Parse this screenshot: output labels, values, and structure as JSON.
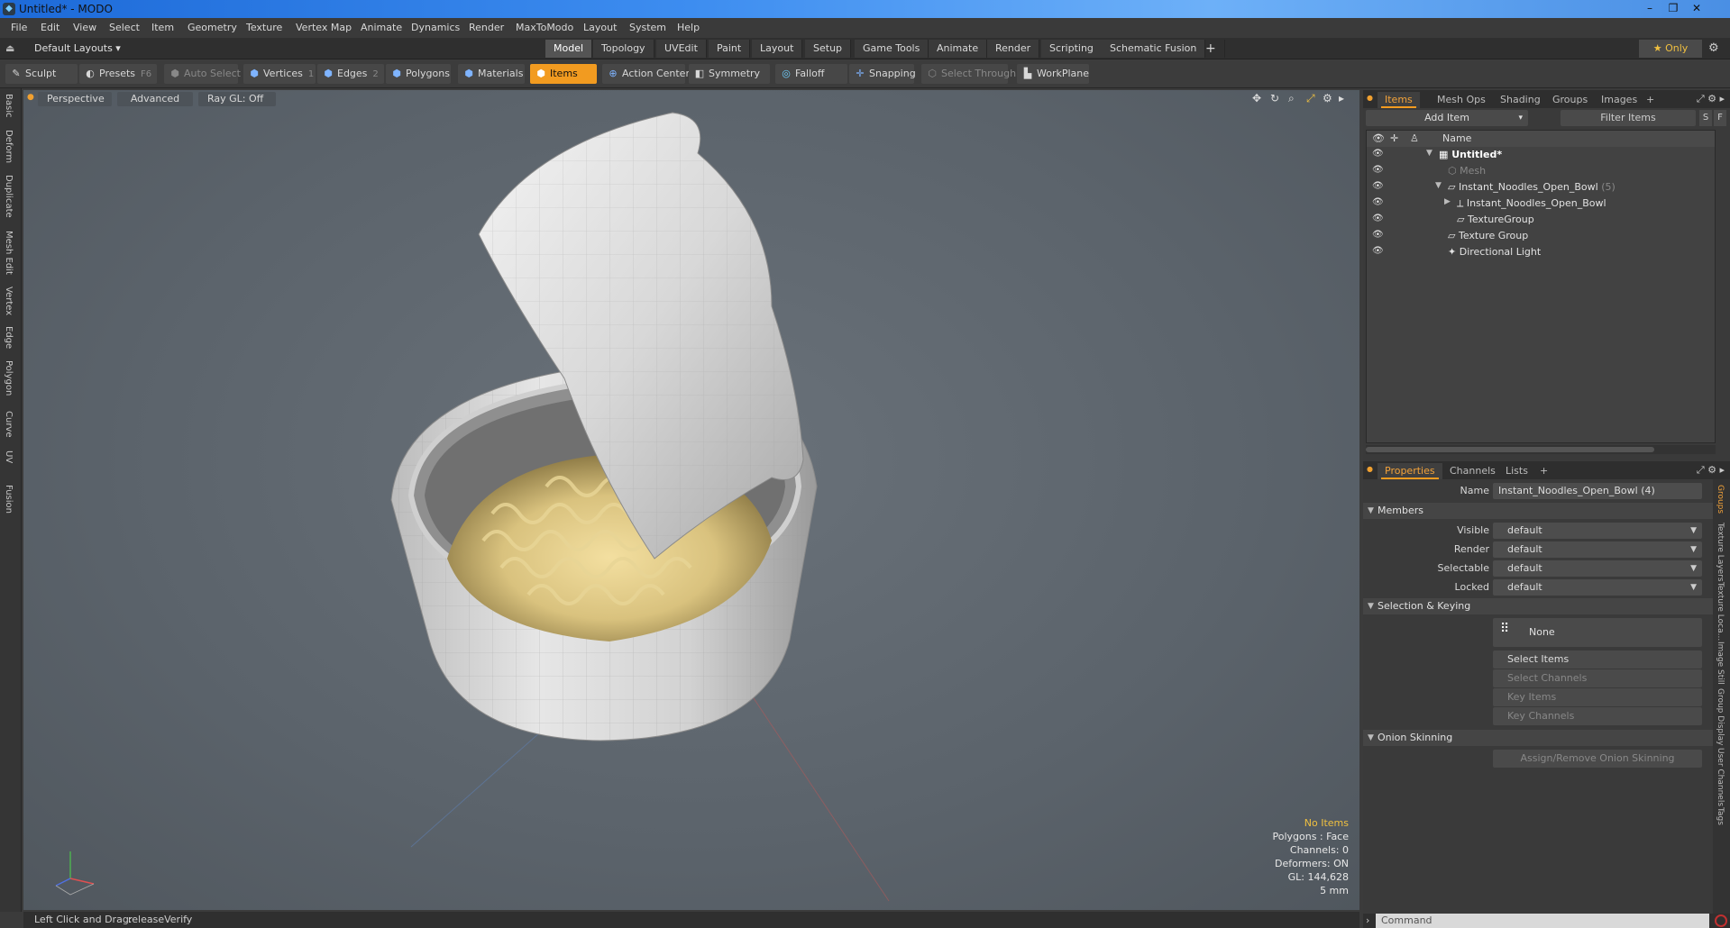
{
  "window": {
    "title": "Untitled* - MODO",
    "icon": "modo-app-icon",
    "controls": [
      "–",
      "❐",
      "✕"
    ]
  },
  "menu": [
    "File",
    "Edit",
    "View",
    "Select",
    "Item",
    "Geometry",
    "Texture",
    "Vertex Map",
    "Animate",
    "Dynamics",
    "Render",
    "MaxToModo",
    "Layout",
    "System",
    "Help"
  ],
  "layout_bar": {
    "layout_dropdown": "Default Layouts ▾",
    "tabs": [
      "Model",
      "Topology",
      "UVEdit",
      "Paint",
      "Layout",
      "Setup",
      "Game Tools",
      "Animate",
      "Render",
      "Scripting",
      "Schematic Fusion"
    ],
    "active_tab": "Model",
    "plus": "+",
    "only": "★ Only"
  },
  "toolbar": {
    "sculpt": "Sculpt",
    "presets": "Presets",
    "presets_key": "F6",
    "auto_select": "Auto Select",
    "vertices": "Vertices",
    "vertices_key": "1",
    "edges": "Edges",
    "edges_key": "2",
    "polygons": "Polygons",
    "materials": "Materials",
    "items": "Items",
    "action_center": "Action Center",
    "symmetry": "Symmetry",
    "falloff": "Falloff",
    "snapping": "Snapping",
    "select_through": "Select Through",
    "workplane": "WorkPlane"
  },
  "left_tabs": [
    "Basic",
    "Deform",
    "Duplicate",
    "Mesh Edit",
    "Vertex",
    "Edge",
    "Polygon",
    "Curve",
    "UV",
    "Fusion"
  ],
  "viewport": {
    "view": "Perspective",
    "advanced": "Advanced",
    "raygl": "Ray GL: Off",
    "info": {
      "no_items": "No Items",
      "polygons": "Polygons : Face",
      "channels": "Channels: 0",
      "deformers": "Deformers: ON",
      "gl": "GL: 144,628",
      "unit": "5 mm"
    }
  },
  "status": {
    "label": "Left Click and Drag:",
    "value": "releaseVerify"
  },
  "items_panel": {
    "tabs": [
      "Items",
      "Mesh Ops",
      "Shading",
      "Groups",
      "Images"
    ],
    "active": "Items",
    "plus": "+",
    "add_item": "Add Item",
    "filter": "Filter Items",
    "s": "S",
    "f": "F",
    "col_name": "Name",
    "rows": [
      {
        "label": "Untitled*",
        "style": "bold"
      },
      {
        "label": "Mesh",
        "style": "dim"
      },
      {
        "label": "Instant_Noodles_Open_Bowl",
        "count": "(5)"
      },
      {
        "label": "Instant_Noodles_Open_Bowl"
      },
      {
        "label": "TextureGroup"
      },
      {
        "label": "Texture Group"
      },
      {
        "label": "Directional Light"
      }
    ]
  },
  "properties_panel": {
    "tabs": [
      "Properties",
      "Channels",
      "Lists"
    ],
    "active": "Properties",
    "plus": "+",
    "name_label": "Name",
    "name_value": "Instant_Noodles_Open_Bowl (4)",
    "members": "Members",
    "visible_label": "Visible",
    "visible_value": "default",
    "render_label": "Render",
    "render_value": "default",
    "selectable_label": "Selectable",
    "selectable_value": "default",
    "locked_label": "Locked",
    "locked_value": "default",
    "sel_keying": "Selection & Keying",
    "none": "None",
    "select_items": "Select Items",
    "select_channels": "Select Channels",
    "key_items": "Key Items",
    "key_channels": "Key Channels",
    "onion": "Onion Skinning",
    "assign_onion": "Assign/Remove Onion Skinning",
    "side_tabs": [
      "Groups",
      "Texture Layers",
      "Texture Loca...",
      "Image Still",
      "Group Display",
      "User Channels",
      "Tags"
    ]
  },
  "command": {
    "placeholder": "Command"
  }
}
